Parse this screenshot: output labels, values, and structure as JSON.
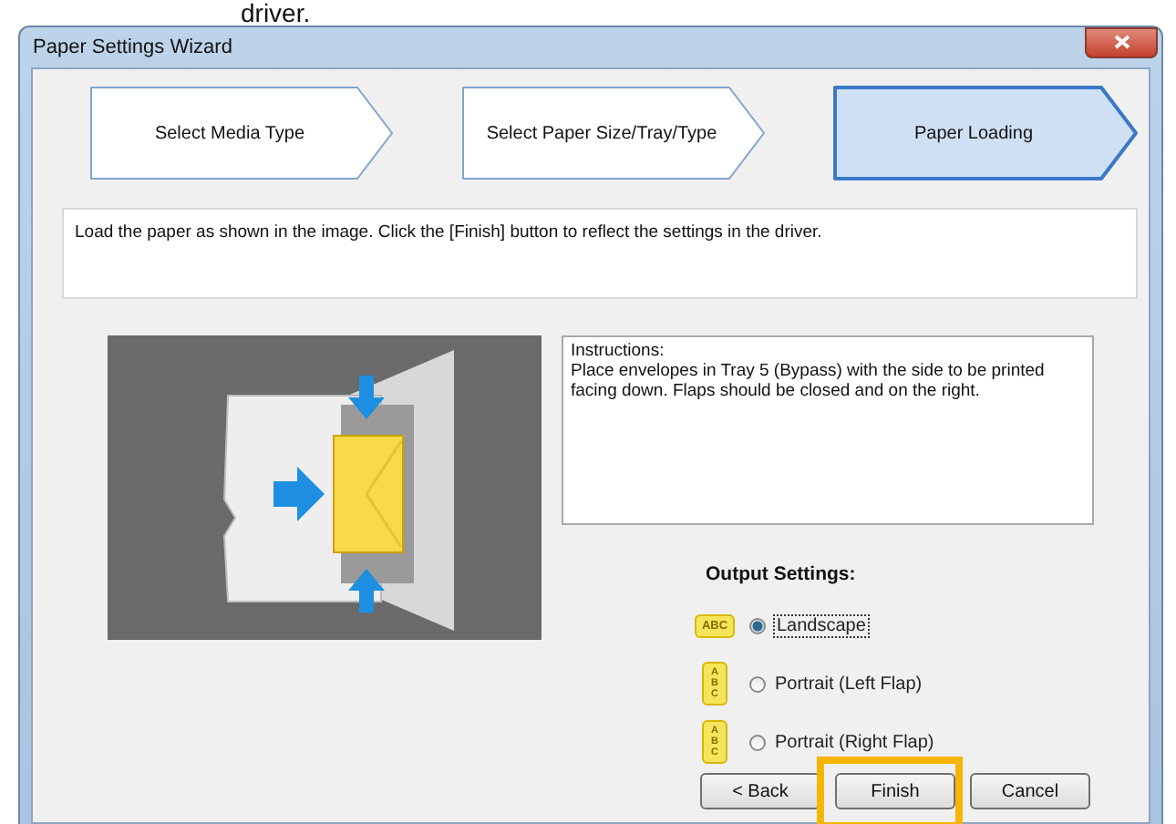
{
  "caption": "driver.",
  "window": {
    "title": "Paper Settings Wizard"
  },
  "steps": [
    {
      "label": "Select Media Type",
      "selected": false
    },
    {
      "label": "Select Paper Size/Tray/Type",
      "selected": false
    },
    {
      "label": "Paper Loading",
      "selected": true
    }
  ],
  "message": "Load the paper as shown in the image. Click the [Finish] button to reflect the settings in the driver.",
  "instructions": {
    "heading": "Instructions:",
    "text": "Place envelopes in Tray 5 (Bypass) with the side to be printed facing down. Flaps should be closed and on the right."
  },
  "output_settings": {
    "label": "Output Settings:",
    "options": [
      {
        "kind": "landscape",
        "icon_text": "ABC",
        "label": "Landscape",
        "selected": true
      },
      {
        "kind": "portrait",
        "icon_text": "ABC",
        "label": "Portrait (Left Flap)",
        "selected": false
      },
      {
        "kind": "portrait",
        "icon_text": "ABC",
        "label": "Portrait (Right Flap)",
        "selected": false
      }
    ]
  },
  "buttons": [
    {
      "label": "< Back",
      "highlighted": false
    },
    {
      "label": "Finish",
      "highlighted": true
    },
    {
      "label": "Cancel",
      "highlighted": false
    }
  ]
}
